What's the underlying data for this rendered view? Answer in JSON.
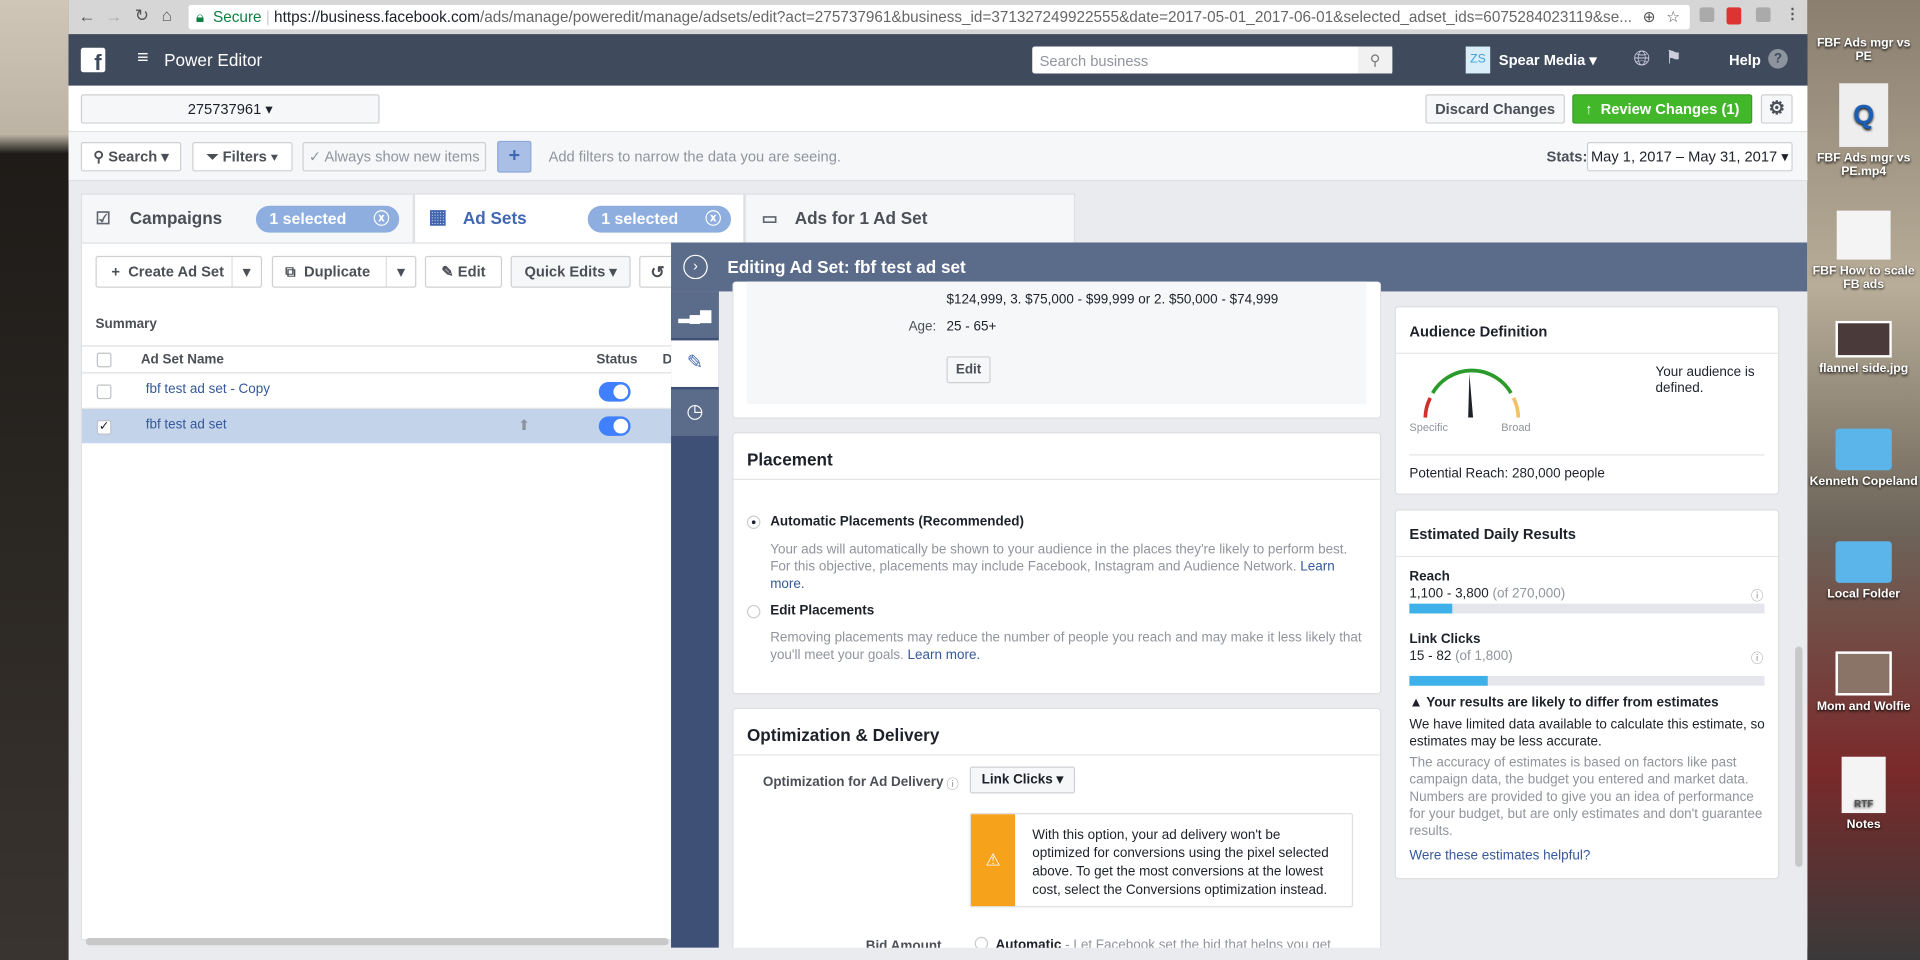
{
  "browser": {
    "secure": "Secure",
    "url_host": "https://business.facebook.com",
    "url_path": "/ads/manage/poweredit/manage/adsets/edit?act=275737961&business_id=371327249922555&date=2017-05-01_2017-06-01&selected_adset_ids=6075284023119&se..."
  },
  "header": {
    "app_title": "Power Editor",
    "search_placeholder": "Search business",
    "account_initials": "ZS",
    "account_name": "Spear Media",
    "help": "Help"
  },
  "account_bar": {
    "account_id": "275737961",
    "discard": "Discard Changes",
    "review": "Review Changes (1)"
  },
  "filters": {
    "search": "Search",
    "filters": "Filters",
    "always_show": "Always show new items",
    "hint": "Add filters to narrow the data you are seeing.",
    "stats_label": "Stats:",
    "date_range": "May 1, 2017 – May 31, 2017"
  },
  "tabs": {
    "campaigns": "Campaigns",
    "campaigns_selected": "1 selected",
    "adsets": "Ad Sets",
    "adsets_selected": "1 selected",
    "ads": "Ads for 1 Ad Set"
  },
  "toolbar": {
    "create": "Create Ad Set",
    "duplicate": "Duplicate",
    "edit": "Edit",
    "quick_edits": "Quick Edits"
  },
  "table": {
    "summary": "Summary",
    "col_name": "Ad Set Name",
    "col_status": "Status",
    "col_d": "D",
    "rows": [
      {
        "name": "fbf test ad set - Copy",
        "selected": false,
        "active": true
      },
      {
        "name": "fbf test ad set",
        "selected": true,
        "active": true
      }
    ]
  },
  "editor": {
    "title": "Editing Ad Set: fbf test ad set",
    "audience": {
      "income_line": "$124,999, 3. $75,000 - $99,999 or 2. $50,000 - $74,999",
      "age_label": "Age:",
      "age_value": "25 - 65+",
      "edit": "Edit"
    },
    "placement": {
      "title": "Placement",
      "auto_label": "Automatic Placements (Recommended)",
      "auto_desc": "Your ads will automatically be shown to your audience in the places they're likely to perform best. For this objective, placements may include Facebook, Instagram and Audience Network.",
      "learn_more": "Learn more.",
      "edit_label": "Edit Placements",
      "edit_desc": "Removing placements may reduce the number of people you reach and may make it less likely that you'll meet your goals.",
      "selected": "automatic"
    },
    "optimization": {
      "title": "Optimization & Delivery",
      "label": "Optimization for Ad Delivery",
      "value": "Link Clicks",
      "warning": "With this option, your ad delivery won't be optimized for conversions using the pixel selected above. To get the most conversions at the lowest cost, select the Conversions optimization instead.",
      "bid_label": "Bid Amount",
      "bid_auto": "Automatic",
      "bid_desc": " - Let Facebook set the bid that helps you get"
    },
    "audience_def": {
      "title": "Audience Definition",
      "specific": "Specific",
      "broad": "Broad",
      "status": "Your audience is defined.",
      "reach": "Potential Reach: 280,000 people"
    },
    "estimates": {
      "title": "Estimated Daily Results",
      "reach_label": "Reach",
      "reach_range": "1,100 - 3,800",
      "reach_of": "(of 270,000)",
      "reach_fill_pct": 12,
      "clicks_label": "Link Clicks",
      "clicks_range": "15 - 82",
      "clicks_of": "(of 1,800)",
      "clicks_fill_pct": 22,
      "warn_title": "Your results are likely to differ from estimates",
      "warn_body": "We have limited data available to calculate this estimate, so estimates may be less accurate.",
      "accuracy": "The accuracy of estimates is based on factors like past campaign data, the budget you entered and market data. Numbers are provided to give you an idea of performance for your budget, but are only estimates and don't guarantee results.",
      "helpful": "Were these estimates helpful?"
    }
  },
  "desktop": [
    "FBF Ads mgr vs PE",
    "FBF Ads mgr vs PE.mp4",
    "FBF How to scale FB ads",
    "flannel side.jpg",
    "Kenneth Copeland",
    "Local Folder",
    "Mom and Wolfie",
    "Notes"
  ],
  "colors": {
    "review_green": "#42b72a",
    "header": "#3f4a5c",
    "panel_header": "#5b6b8a",
    "rail": "#3e5075",
    "toggle": "#4080ff",
    "warning": "#f7a21b"
  }
}
